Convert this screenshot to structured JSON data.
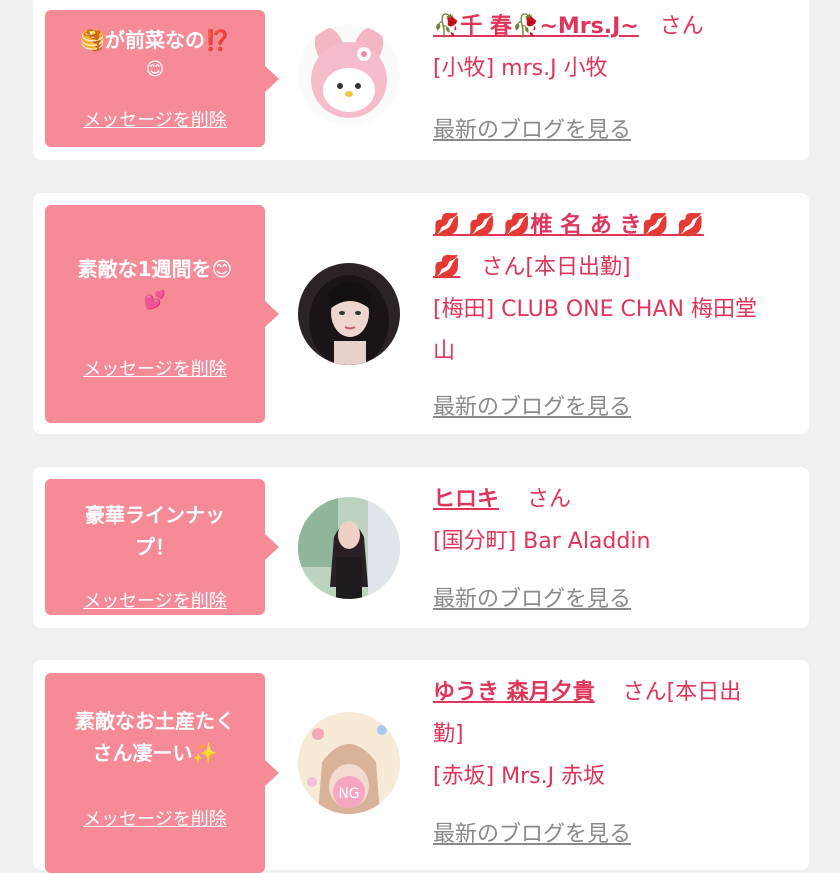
{
  "cards": [
    {
      "message": "🥞が前菜なの⁉️",
      "message_emoji": "😊",
      "delete_label": "メッセージを削除",
      "name": "🥀千 春🥀~Mrs.J~",
      "suffix": "さん",
      "shop": "[小牧] mrs.J 小牧",
      "blog_label": "最新のブログを見る"
    },
    {
      "message": "素敵な1週間を😊",
      "message_emoji": "💕",
      "delete_label": "メッセージを削除",
      "name": "💋 💋 💋椎 名 あ き💋 💋",
      "name_line2": "💋",
      "suffix": "さん[本日出勤]",
      "shop": "[梅田] CLUB ONE CHAN 梅田堂",
      "shop_line2": "山",
      "blog_label": "最新のブログを見る"
    },
    {
      "message": "豪華ラインナッ",
      "message_line2": "プ！",
      "delete_label": "メッセージを削除",
      "name": "ヒロキ",
      "suffix": "さん",
      "shop": "[国分町] Bar Aladdin",
      "blog_label": "最新のブログを見る"
    },
    {
      "message": "素敵なお土産たく",
      "message_line2": "さん凄ーい✨",
      "delete_label": "メッセージを削除",
      "name": "ゆうき 森月夕貴",
      "suffix": "さん[本日出",
      "suffix_line2": "勤]",
      "shop": "[赤坂] Mrs.J 赤坂",
      "blog_label": "最新のブログを見る",
      "avatar_badge": "NG"
    }
  ],
  "colors": {
    "bubble": "#f78a97",
    "accent": "#e0355a",
    "muted": "#8a8a8a",
    "background": "#f0f0f0"
  },
  "icons": [
    "pancake-emoji",
    "smile-emoji",
    "hearts-emoji",
    "sparkle-emoji",
    "lips-emoji",
    "rose-emoji"
  ]
}
